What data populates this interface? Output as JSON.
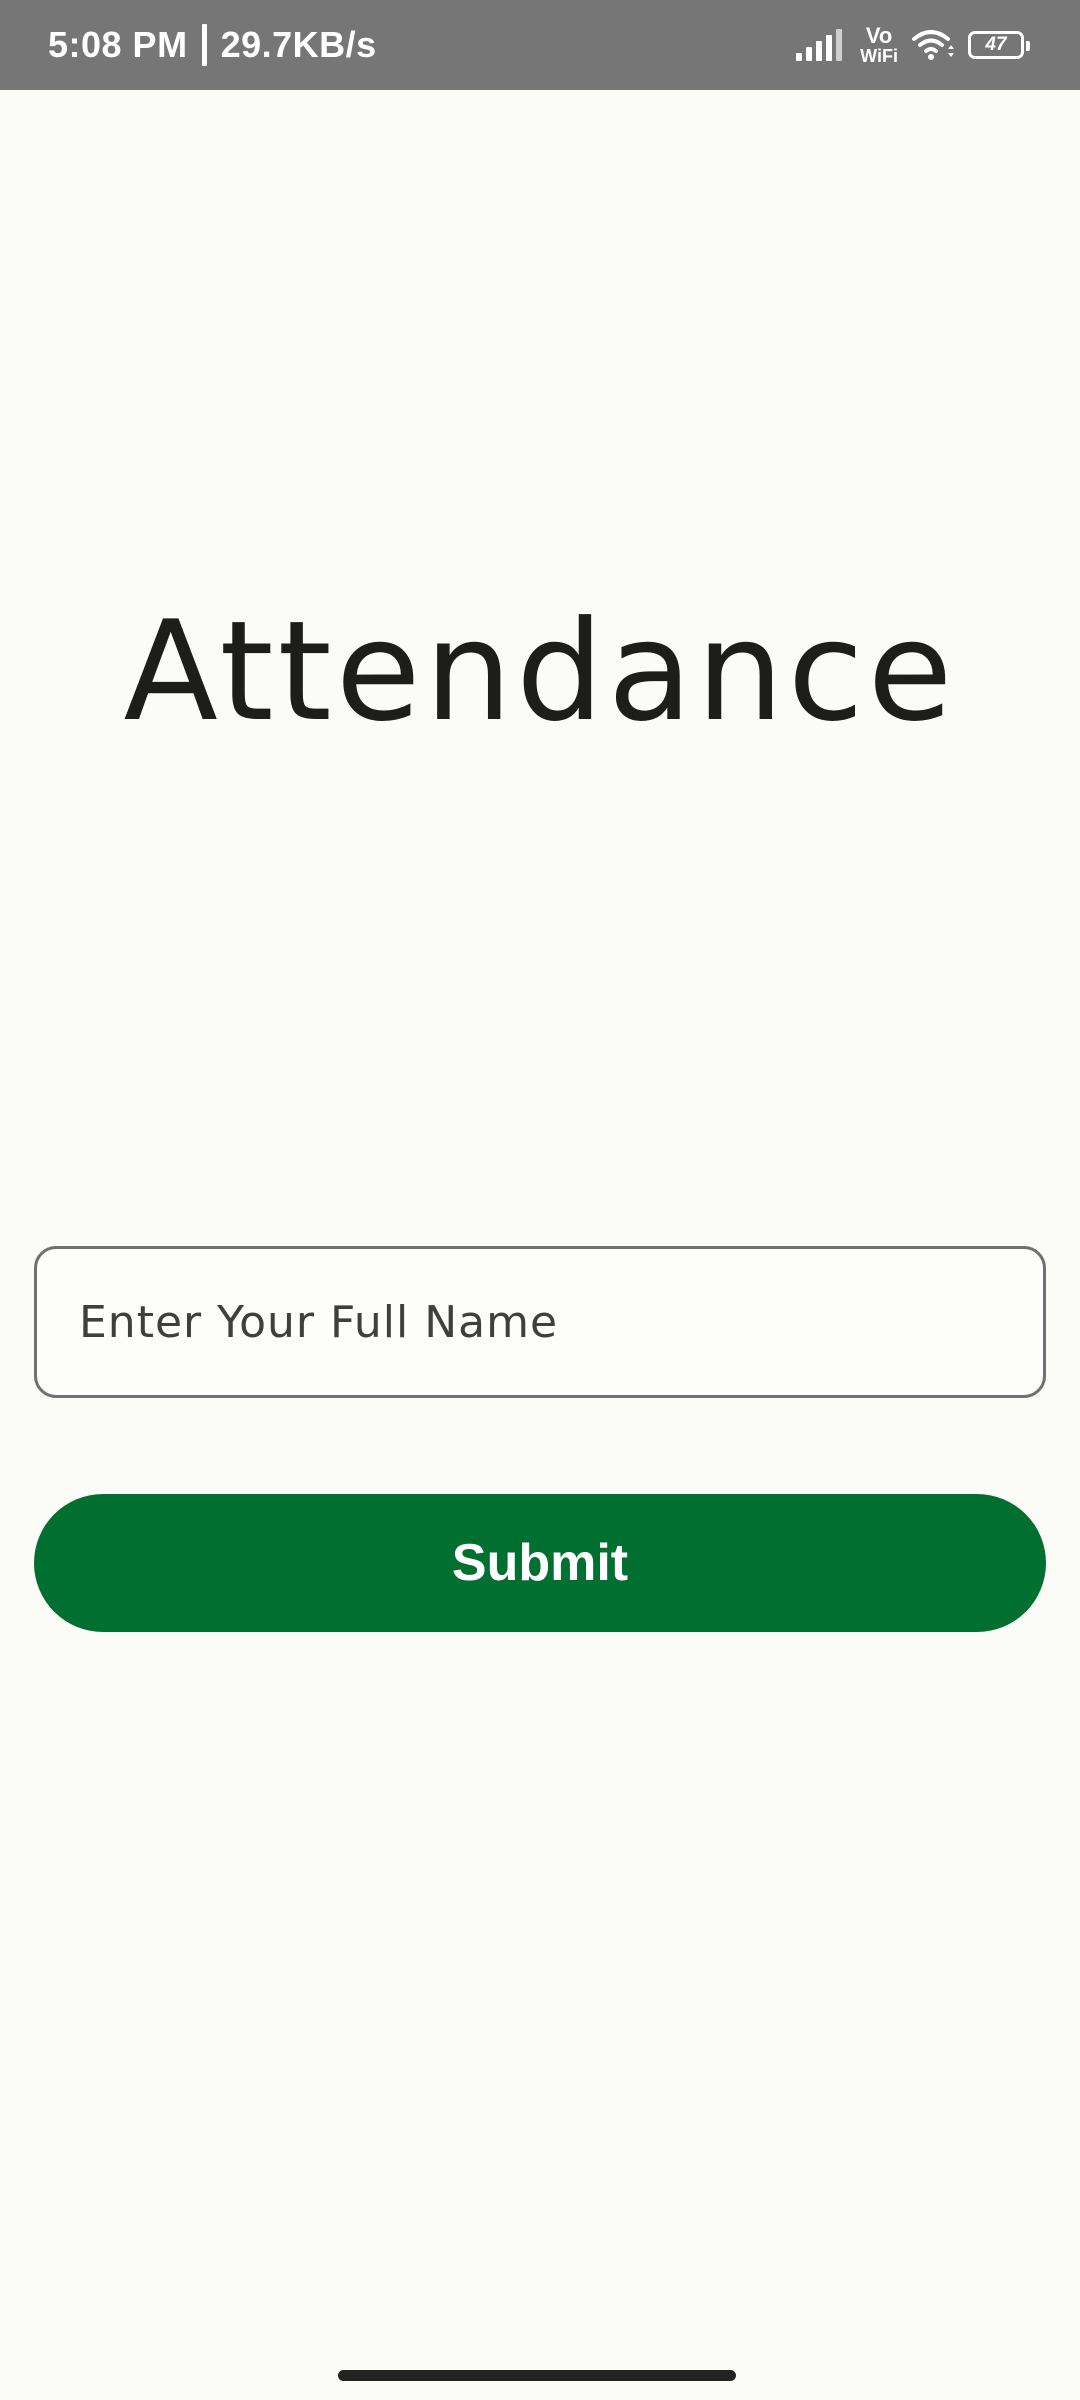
{
  "status_bar": {
    "time": "5:08 PM",
    "network_speed": "29.7KB/s",
    "vowifi_top": "Vo",
    "vowifi_bottom": "WiFi",
    "battery_level": "47",
    "icons": [
      "signal-icon",
      "vowifi-icon",
      "wifi-icon",
      "battery-icon"
    ]
  },
  "page": {
    "title": "Attendance"
  },
  "form": {
    "name_input": {
      "value": "",
      "placeholder": "Enter Your Full Name"
    },
    "submit_label": "Submit"
  },
  "colors": {
    "background": "#fbfbf7",
    "status_bar": "#767676",
    "accent_button": "#006f2f",
    "title_text": "#1d1d1b",
    "input_border": "#707070"
  }
}
